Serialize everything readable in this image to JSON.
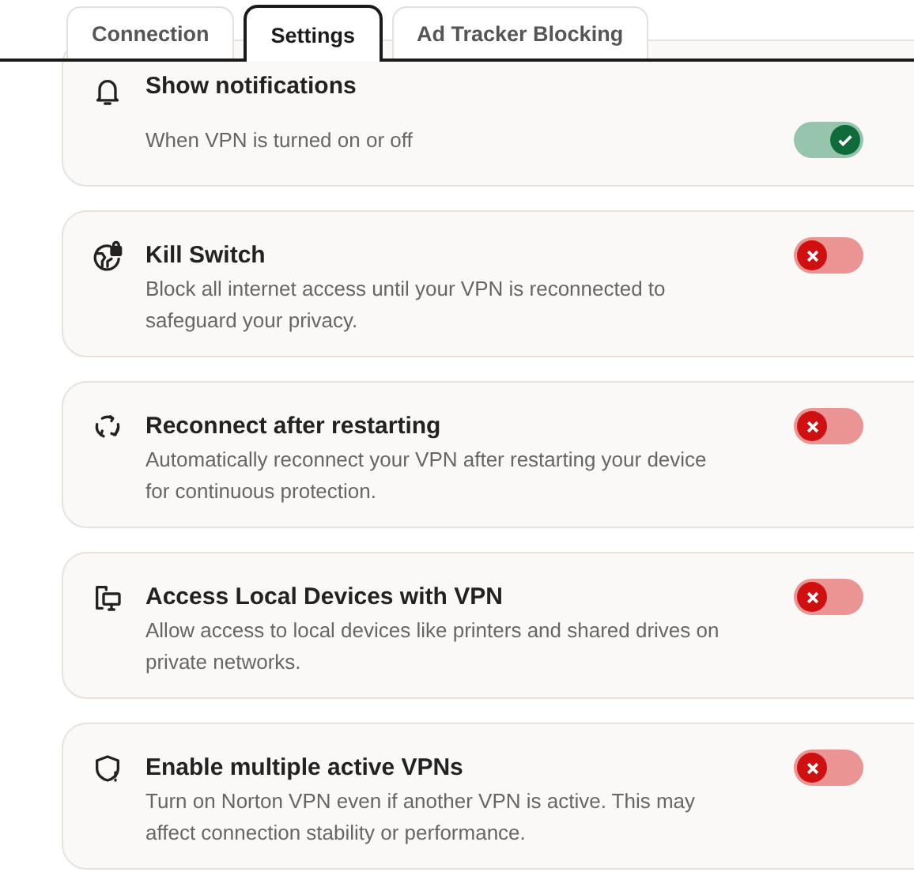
{
  "tabs": [
    {
      "label": "Connection",
      "selected": false
    },
    {
      "label": "Settings",
      "selected": true
    },
    {
      "label": "Ad Tracker Blocking",
      "selected": false
    }
  ],
  "settings": [
    {
      "kind": "split",
      "title": "Show notifications",
      "description": "When VPN is turned on or off",
      "on": true
    },
    {
      "kind": "inline",
      "title": "Kill Switch",
      "description": "Block all internet access until your VPN is reconnected to safeguard your privacy.",
      "on": false
    },
    {
      "kind": "inline",
      "title": "Reconnect after restarting",
      "description": "Automatically reconnect your VPN after restarting your device for continuous protection.",
      "on": false
    },
    {
      "kind": "inline",
      "title": "Access Local Devices with VPN",
      "description": "Allow access to local devices like printers and shared drives on private networks.",
      "on": false
    },
    {
      "kind": "inline",
      "title": "Enable multiple active VPNs",
      "description": "Turn on Norton VPN even if another VPN is active. This may affect connection stability or performance.",
      "on": false
    }
  ]
}
